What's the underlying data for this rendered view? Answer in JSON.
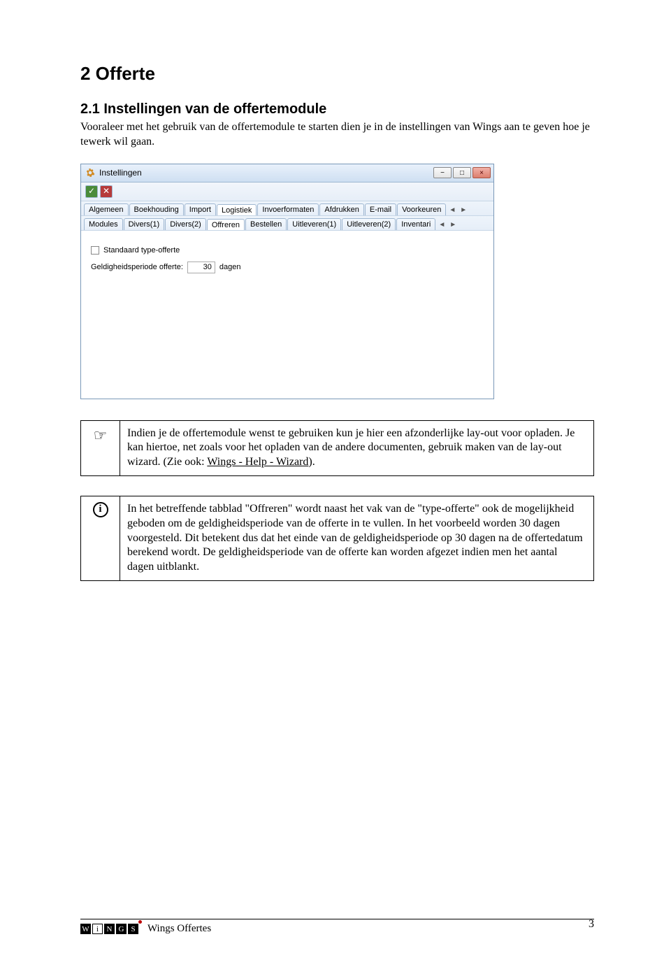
{
  "heading": "2  Offerte",
  "subheading": "2.1 Instellingen van de offertemodule",
  "intro": "Vooraleer met het gebruik van de offertemodule te starten dien je in de instellingen van Wings aan te geven hoe je tewerk wil gaan.",
  "app": {
    "title": "Instellingen",
    "buttons": {
      "min": "−",
      "max": "□",
      "close": "×"
    },
    "tabs1": [
      "Algemeen",
      "Boekhouding",
      "Import",
      "Logistiek",
      "Invoerformaten",
      "Afdrukken",
      "E-mail",
      "Voorkeuren"
    ],
    "tabs1_active": 3,
    "tabs2": [
      "Modules",
      "Divers(1)",
      "Divers(2)",
      "Offreren",
      "Bestellen",
      "Uitleveren(1)",
      "Uitleveren(2)",
      "Inventari"
    ],
    "tabs2_active": 3,
    "fields": {
      "checkbox_label": "Standaard type-offerte",
      "validity_label": "Geldigheidsperiode offerte:",
      "validity_value": "30",
      "validity_unit": "dagen"
    }
  },
  "note1": {
    "icon": "☞",
    "text_before": "Indien je de offertemodule wenst te gebruiken kun je hier een afzonderlijke lay-out voor opladen. Je kan hiertoe, net zoals voor het opladen van de andere documenten, gebruik maken van de lay-out wizard. (Zie ook: ",
    "link": "Wings - Help - Wizard",
    "text_after": ")."
  },
  "note2": {
    "icon": "i",
    "text": "In het betreffende tabblad \"Offreren\" wordt naast het vak van de \"type-offerte\" ook de mogelijkheid geboden om de geldigheidsperiode van de offerte in te vullen. In het voorbeeld worden 30 dagen voorgesteld. Dit betekent dus dat het einde van de geldigheidsperiode op 30 dagen na de offertedatum berekend wordt. De geldigheidsperiode van de offerte kan worden afgezet indien men het aantal dagen uitblankt."
  },
  "footer": {
    "logo_letters": [
      "W",
      "i",
      "N",
      "G",
      "S"
    ],
    "title": "Wings Offertes",
    "page": "3"
  }
}
